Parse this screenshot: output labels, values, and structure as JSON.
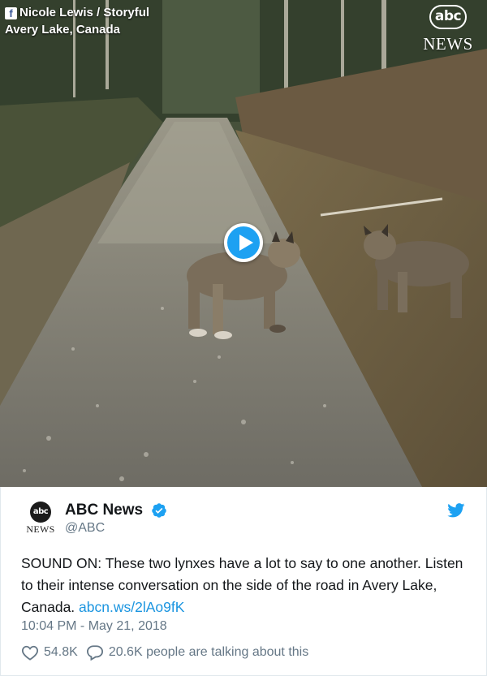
{
  "video": {
    "credit_icon": "facebook-icon",
    "credit_line1": "Nicole Lewis / Storyful",
    "credit_line2": "Avery Lake, Canada",
    "logo_mark": "abc",
    "logo_news": "NEWS",
    "play_icon": "play-icon"
  },
  "tweet": {
    "avatar_mark": "abc",
    "avatar_news": "NEWS",
    "display_name": "ABC News",
    "handle": "@ABC",
    "text_main": "SOUND ON: These two lynxes have a lot to say to one another. Listen to their intense conversation on the side of the road in Avery Lake, Canada. ",
    "link_text": "abcn.ws/2lAo9fK",
    "timestamp": "10:04 PM - May 21, 2018",
    "like_count": "54.8K",
    "reply_text": "20.6K people are talking about this"
  },
  "colors": {
    "accent": "#1da1f2",
    "link": "#1b95e0",
    "secondary_text": "#657786"
  }
}
